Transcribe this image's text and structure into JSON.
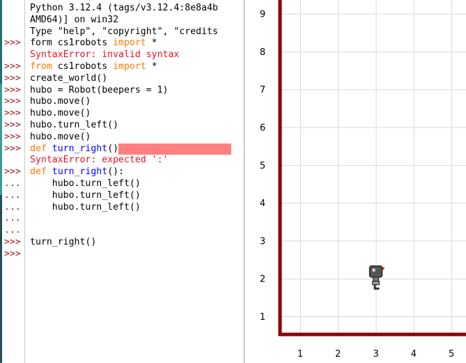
{
  "shell": {
    "lines": [
      {
        "prompt": "",
        "parts": [
          {
            "t": "Python 3.12.4 (tags/v3.12.4:8e8a4b",
            "c": "out"
          }
        ]
      },
      {
        "prompt": "",
        "parts": [
          {
            "t": "AMD64)] on win32",
            "c": "out"
          }
        ]
      },
      {
        "prompt": "",
        "parts": [
          {
            "t": "Type \"help\", \"copyright\", \"credits",
            "c": "out"
          }
        ]
      },
      {
        "prompt": ">>>",
        "parts": [
          {
            "t": "form cs1robots ",
            "c": "out"
          },
          {
            "t": "import",
            "c": "kw"
          },
          {
            "t": " *",
            "c": "out"
          }
        ]
      },
      {
        "prompt": "",
        "parts": [
          {
            "t": "SyntaxError: invalid syntax",
            "c": "err"
          }
        ]
      },
      {
        "prompt": ">>>",
        "parts": [
          {
            "t": "from",
            "c": "kw"
          },
          {
            "t": " cs1robots ",
            "c": "out"
          },
          {
            "t": "import",
            "c": "kw"
          },
          {
            "t": " *",
            "c": "out"
          }
        ]
      },
      {
        "prompt": ">>>",
        "parts": [
          {
            "t": "create_world()",
            "c": "out"
          }
        ]
      },
      {
        "prompt": ">>>",
        "parts": [
          {
            "t": "hubo = Robot(beepers = 1)",
            "c": "out"
          }
        ]
      },
      {
        "prompt": ">>>",
        "parts": [
          {
            "t": "hubo.move()",
            "c": "out"
          }
        ]
      },
      {
        "prompt": ">>>",
        "parts": [
          {
            "t": "hubo.move()",
            "c": "out"
          }
        ]
      },
      {
        "prompt": ">>>",
        "parts": [
          {
            "t": "hubo.turn_left()",
            "c": "out"
          }
        ]
      },
      {
        "prompt": ">>>",
        "parts": [
          {
            "t": "hubo.move()",
            "c": "out"
          }
        ]
      },
      {
        "prompt": ">>>",
        "parts": [
          {
            "t": "def",
            "c": "kw"
          },
          {
            "t": " ",
            "c": "out"
          },
          {
            "t": "turn_right",
            "c": "fn"
          },
          {
            "t": "()",
            "c": "out"
          },
          {
            "t": "",
            "c": "hl"
          }
        ]
      },
      {
        "prompt": "",
        "parts": [
          {
            "t": "SyntaxError: expected ':'",
            "c": "err"
          }
        ]
      },
      {
        "prompt": ">>>",
        "parts": [
          {
            "t": "def",
            "c": "kw"
          },
          {
            "t": " ",
            "c": "out"
          },
          {
            "t": "turn_right",
            "c": "fn"
          },
          {
            "t": "():",
            "c": "out"
          }
        ]
      },
      {
        "prompt": "...",
        "parts": [
          {
            "t": "    hubo.turn_left()",
            "c": "out"
          }
        ]
      },
      {
        "prompt": "...",
        "parts": [
          {
            "t": "    hubo.turn_left()",
            "c": "out"
          }
        ]
      },
      {
        "prompt": "...",
        "parts": [
          {
            "t": "    hubo.turn_left()",
            "c": "out"
          }
        ]
      },
      {
        "prompt": "...",
        "parts": [
          {
            "t": "",
            "c": "out"
          }
        ]
      },
      {
        "prompt": "...",
        "parts": [
          {
            "t": "",
            "c": "out"
          }
        ]
      },
      {
        "prompt": ">>>",
        "parts": [
          {
            "t": "turn_right()",
            "c": "out"
          }
        ]
      },
      {
        "prompt": ">>>",
        "parts": [
          {
            "t": "",
            "c": "out"
          }
        ]
      }
    ]
  },
  "world": {
    "y_labels": [
      "1",
      "2",
      "3",
      "4",
      "5",
      "6",
      "7",
      "8",
      "9"
    ],
    "x_labels": [
      "1",
      "2",
      "3",
      "4",
      "5"
    ],
    "wall_color": "#8b0000",
    "grid_color": "#d9d9d9",
    "robot": {
      "avenue": 3,
      "street": 2,
      "facing": "east",
      "icon": "robot-icon"
    }
  }
}
